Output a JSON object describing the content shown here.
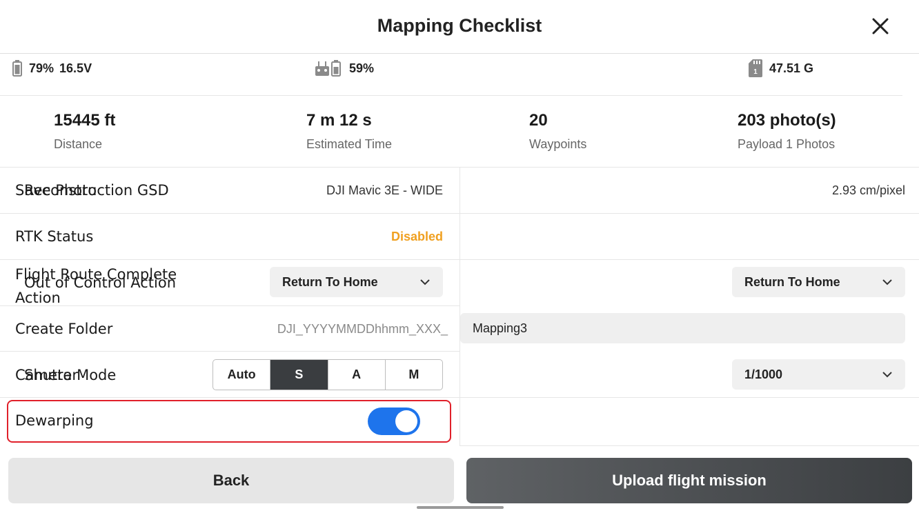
{
  "header": {
    "title": "Mapping Checklist"
  },
  "status": {
    "aircraft_battery": "79%",
    "aircraft_voltage": "16.5V",
    "rc_battery": "59%",
    "storage": "47.51 G",
    "storage_slot": "1"
  },
  "stats": [
    {
      "value": "15445 ft",
      "label": "Distance"
    },
    {
      "value": "7 m 12 s",
      "label": "Estimated Time"
    },
    {
      "value": "20",
      "label": "Waypoints"
    },
    {
      "value": "203 photo(s)",
      "label": "Payload 1 Photos"
    }
  ],
  "settings": {
    "save_photo": {
      "label": "Save Photo",
      "value": "DJI Mavic 3E - WIDE"
    },
    "gsd": {
      "label": "Reconstruction GSD",
      "value": "2.93 cm/pixel"
    },
    "rtk": {
      "label": "RTK Status",
      "value": "Disabled",
      "color": "#f0a020"
    },
    "route_complete": {
      "label_line1": "Flight Route Complete",
      "label_line2": "Action",
      "value": "Return To Home"
    },
    "out_of_control": {
      "label": "Out of Control Action",
      "value": "Return To Home"
    },
    "folder": {
      "label": "Create Folder",
      "prefix": "DJI_YYYYMMDDhhmm_XXX_",
      "name": "Mapping3"
    },
    "camera_mode": {
      "label": "Camera Mode",
      "options": [
        "Auto",
        "S",
        "A",
        "M"
      ],
      "selected": "S"
    },
    "shutter": {
      "label": "Shutter",
      "value": "1/1000"
    },
    "dewarping": {
      "label": "Dewarping",
      "enabled": true
    }
  },
  "footer": {
    "back_label": "Back",
    "upload_label": "Upload flight mission"
  },
  "colors": {
    "accent": "#1e74ec",
    "highlight": "#e0202a",
    "warning": "#f0a020",
    "dark_button": "#3c3f42"
  }
}
